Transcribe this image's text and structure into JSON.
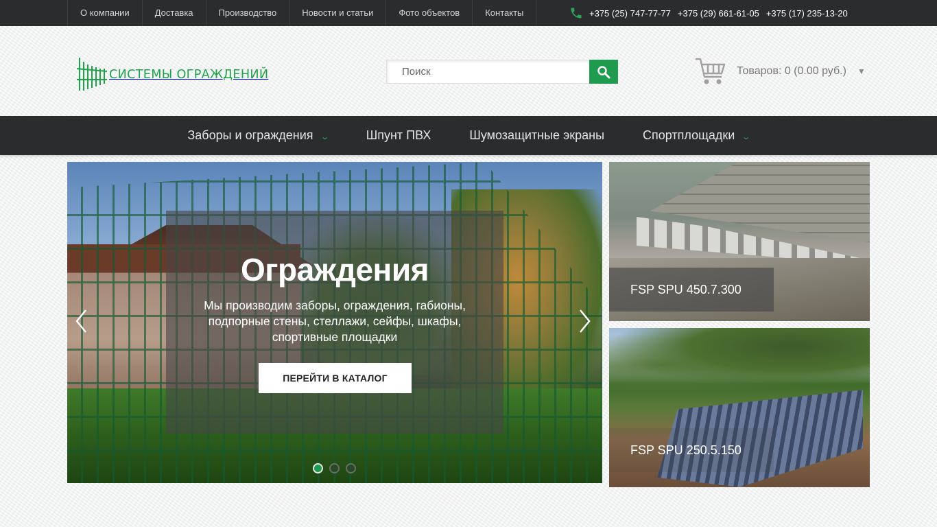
{
  "top_nav": {
    "items": [
      {
        "label": "О компании"
      },
      {
        "label": "Доставка"
      },
      {
        "label": "Производство"
      },
      {
        "label": "Новости и статьи"
      },
      {
        "label": "Фото объектов"
      },
      {
        "label": "Контакты"
      }
    ]
  },
  "phones": {
    "icon": "phone-icon",
    "numbers": [
      "+375 (25) 747-77-77",
      "+375 (29) 661-61-05",
      "+375 (17) 235-13-20"
    ]
  },
  "logo": {
    "text": "СИСТЕМЫ ОГРАЖДЕНИЙ",
    "color": "#1ea24a"
  },
  "search": {
    "placeholder": "Поиск",
    "value": "",
    "button_icon": "search-icon",
    "button_color": "#1f9b4f"
  },
  "cart": {
    "icon": "cart-icon",
    "label": "Товаров: 0 (0.00 руб.)",
    "caret": "▼"
  },
  "main_nav": {
    "items": [
      {
        "label": "Заборы и ограждения",
        "has_dropdown": true
      },
      {
        "label": "Шпунт ПВХ",
        "has_dropdown": false
      },
      {
        "label": "Шумозащитные экраны",
        "has_dropdown": false
      },
      {
        "label": "Спортплощадки",
        "has_dropdown": true
      }
    ],
    "chevron": "⌄"
  },
  "slider": {
    "title": "Ограждения",
    "description": "Мы производим заборы, ограждения, габионы, подпорные стены, стеллажи, сейфы, шкафы, спортивные площадки",
    "button_label": "ПЕРЕЙТИ В КАТАЛОГ",
    "slide_count": 3,
    "active_slide": 1,
    "accent_color": "#1f9b4f"
  },
  "promos": [
    {
      "label": "FSP SPU 450.7.300"
    },
    {
      "label": "FSP SPU 250.5.150"
    }
  ]
}
